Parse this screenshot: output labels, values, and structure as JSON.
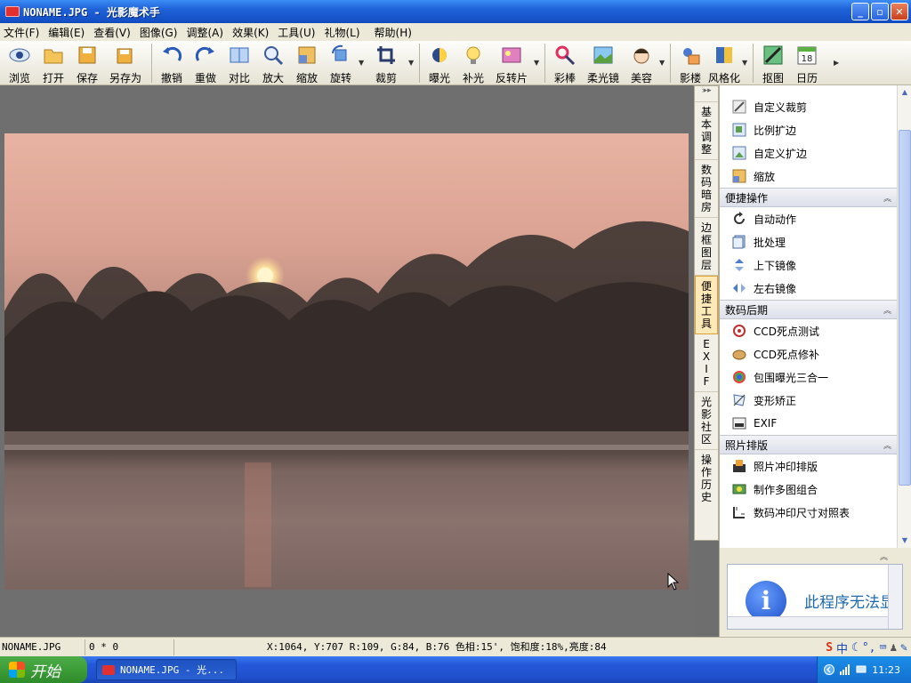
{
  "window": {
    "title": "NONAME.JPG - 光影魔术手"
  },
  "menu": [
    "文件(F)",
    "编辑(E)",
    "查看(V)",
    "图像(G)",
    "调整(A)",
    "效果(K)",
    "工具(U)",
    "礼物(L)",
    "帮助(H)"
  ],
  "toolbar": {
    "browse": "浏览",
    "open": "打开",
    "save": "保存",
    "save_as": "另存为",
    "undo": "撤销",
    "redo": "重做",
    "compare": "对比",
    "zoom_in": "放大",
    "resize": "缩放",
    "rotate": "旋转",
    "crop": "裁剪",
    "exposure": "曝光",
    "fill_light": "补光",
    "reverse": "反转片",
    "color_pen": "彩棒",
    "soft_focus": "柔光镜",
    "beauty": "美容",
    "shadow_building": "影楼",
    "stylize": "风格化",
    "cutout": "抠图",
    "calendar": "日历",
    "calendar_day": "18"
  },
  "vtabs": {
    "basic": [
      "基",
      "本",
      "调",
      "整"
    ],
    "darkroom": [
      "数",
      "码",
      "暗",
      "房"
    ],
    "border": [
      "边",
      "框",
      "图",
      "层"
    ],
    "quick": [
      "便",
      "捷",
      "工",
      "具"
    ],
    "exif": [
      "E",
      "X",
      "I",
      "F"
    ],
    "community": [
      "光",
      "影",
      "社",
      "区"
    ],
    "history": [
      "操",
      "作",
      "历",
      "史"
    ]
  },
  "panel": {
    "crop_items": [
      "自定义裁剪",
      "比例扩边",
      "自定义扩边",
      "缩放"
    ],
    "quick_title": "便捷操作",
    "quick_items": [
      "自动动作",
      "批处理",
      "上下镜像",
      "左右镜像"
    ],
    "darkroom_title": "数码后期",
    "darkroom_items": [
      "CCD死点测试",
      "CCD死点修补",
      "包围曝光三合一",
      "变形矫正",
      "EXIF"
    ],
    "layout_title": "照片排版",
    "layout_items": [
      "照片冲印排版",
      "制作多图组合",
      "数码冲印尺寸对照表"
    ]
  },
  "infobox": {
    "text": "此程序无法显示"
  },
  "status": {
    "filename": "NONAME.JPG",
    "dims": "0 * 0",
    "pixel_info": "X:1064, Y:707 R:109, G:84, B:76 色相:15', 饱和度:18%,亮度:84"
  },
  "taskbar": {
    "start": "开始",
    "task": "NONAME.JPG - 光...",
    "clock": "11:23"
  },
  "ime": {
    "lang": "中"
  }
}
